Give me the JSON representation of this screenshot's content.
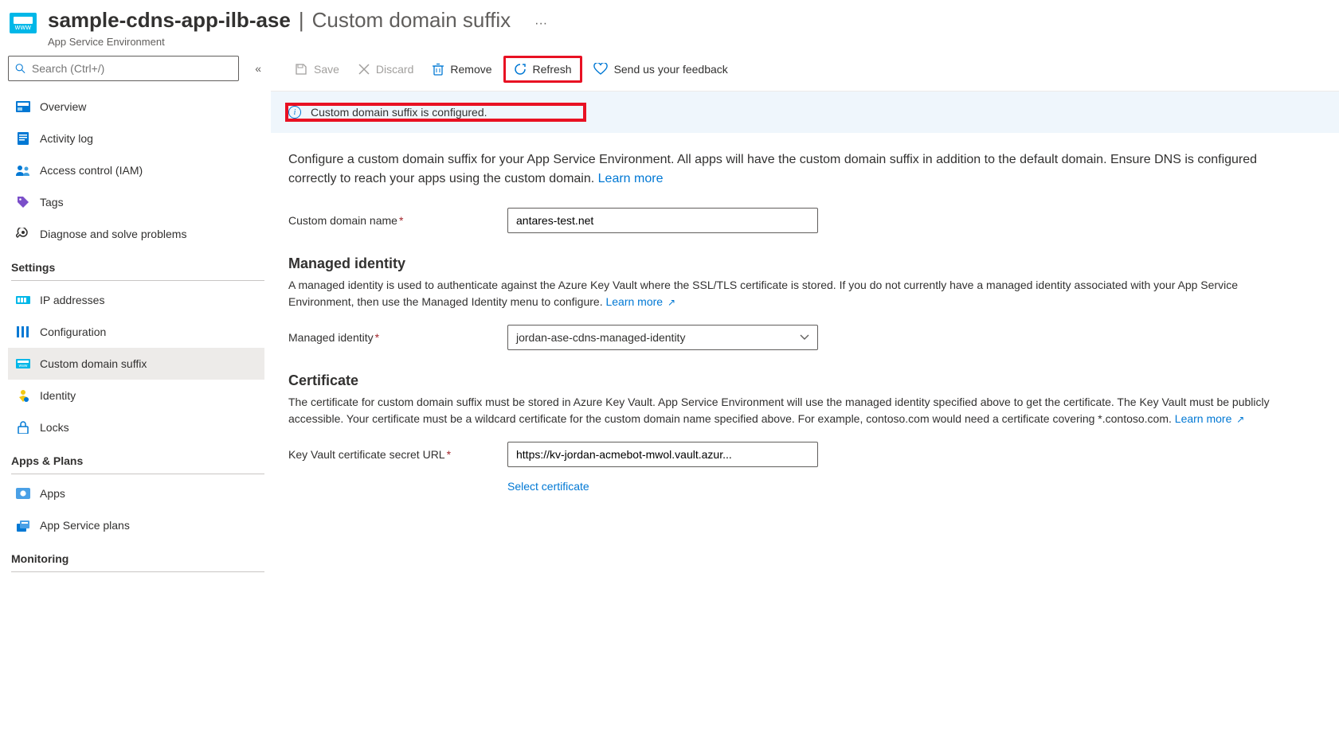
{
  "header": {
    "resource_name": "sample-cdns-app-ilb-ase",
    "page_name": "Custom domain suffix",
    "resource_type": "App Service Environment"
  },
  "sidebar": {
    "search_placeholder": "Search (Ctrl+/)",
    "top_items": [
      {
        "label": "Overview"
      },
      {
        "label": "Activity log"
      },
      {
        "label": "Access control (IAM)"
      },
      {
        "label": "Tags"
      },
      {
        "label": "Diagnose and solve problems"
      }
    ],
    "sections": [
      {
        "title": "Settings",
        "items": [
          {
            "label": "IP addresses"
          },
          {
            "label": "Configuration"
          },
          {
            "label": "Custom domain suffix",
            "active": true
          },
          {
            "label": "Identity"
          },
          {
            "label": "Locks"
          }
        ]
      },
      {
        "title": "Apps & Plans",
        "items": [
          {
            "label": "Apps"
          },
          {
            "label": "App Service plans"
          }
        ]
      },
      {
        "title": "Monitoring",
        "items": []
      }
    ]
  },
  "toolbar": {
    "save": "Save",
    "discard": "Discard",
    "remove": "Remove",
    "refresh": "Refresh",
    "feedback": "Send us your feedback"
  },
  "banner": {
    "text": "Custom domain suffix is configured."
  },
  "main": {
    "description": "Configure a custom domain suffix for your App Service Environment. All apps will have the custom domain suffix in addition to the default domain. Ensure DNS is configured correctly to reach your apps using the custom domain. ",
    "learn_more": "Learn more",
    "domain_label": "Custom domain name",
    "domain_value": "antares-test.net",
    "identity_heading": "Managed identity",
    "identity_desc": "A managed identity is used to authenticate against the Azure Key Vault where the SSL/TLS certificate is stored. If you do not currently have a managed identity associated with your App Service Environment, then use the Managed Identity menu to configure. ",
    "identity_label": "Managed identity",
    "identity_value": "jordan-ase-cdns-managed-identity",
    "cert_heading": "Certificate",
    "cert_desc": "The certificate for custom domain suffix must be stored in Azure Key Vault. App Service Environment will use the managed identity specified above to get the certificate. The Key Vault must be publicly accessible. Your certificate must be a wildcard certificate for the custom domain name specified above. For example, contoso.com would need a certificate covering *.contoso.com. ",
    "cert_url_label": "Key Vault certificate secret URL",
    "cert_url_value": "https://kv-jordan-acmebot-mwol.vault.azur...",
    "select_cert": "Select certificate"
  }
}
